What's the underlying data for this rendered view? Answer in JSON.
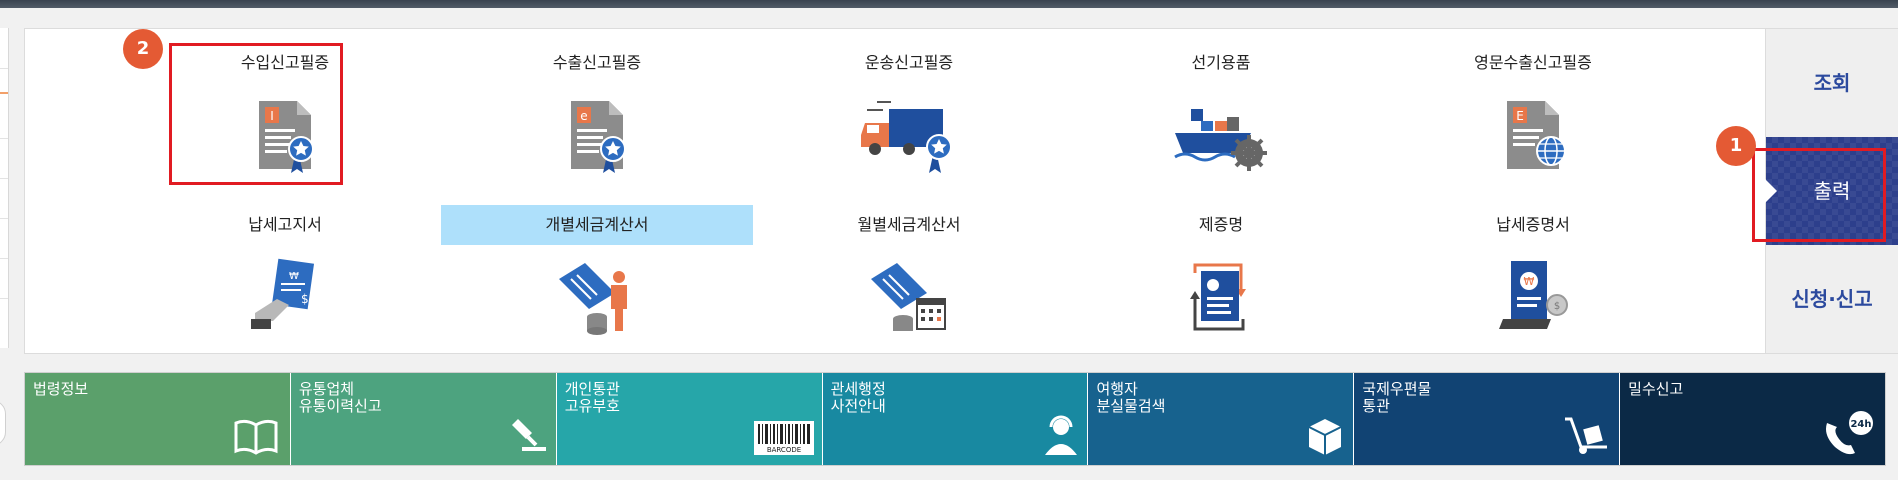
{
  "grid": {
    "items": [
      {
        "label": "수입신고필증",
        "icon": "import-declaration-certificate-icon"
      },
      {
        "label": "수출신고필증",
        "icon": "export-declaration-certificate-icon"
      },
      {
        "label": "운송신고필증",
        "icon": "transport-declaration-certificate-icon"
      },
      {
        "label": "선기용품",
        "icon": "ship-supplies-icon"
      },
      {
        "label": "영문수출신고필증",
        "icon": "english-export-certificate-icon"
      },
      {
        "label": "납세고지서",
        "icon": "tax-notice-icon"
      },
      {
        "label": "개별세금계산서",
        "icon": "individual-tax-invoice-icon"
      },
      {
        "label": "월별세금계산서",
        "icon": "monthly-tax-invoice-icon"
      },
      {
        "label": "제증명",
        "icon": "certificate-icon"
      },
      {
        "label": "납세증명서",
        "icon": "tax-payment-certificate-icon"
      }
    ],
    "selected_index": 6
  },
  "annotations": {
    "badge_1": "1",
    "badge_2": "2"
  },
  "side_tabs": {
    "items": [
      {
        "label": "조회"
      },
      {
        "label": "출력"
      },
      {
        "label": "신청·신고"
      }
    ],
    "active_index": 1
  },
  "services": {
    "items": [
      {
        "lines": [
          "법령정보"
        ],
        "color": "#5ba06b",
        "icon": "book-icon"
      },
      {
        "lines": [
          "유통업체",
          "유통이력신고"
        ],
        "color": "#4da37f",
        "icon": "stamp-icon"
      },
      {
        "lines": [
          "개인통관",
          "고유부호"
        ],
        "color": "#26a6a9",
        "icon": "barcode-icon",
        "icon_text": "BARCODE"
      },
      {
        "lines": [
          "관세행정",
          "사전안내"
        ],
        "color": "#1889a1",
        "icon": "headset-person-icon"
      },
      {
        "lines": [
          "여행자",
          "분실물검색"
        ],
        "color": "#17628e",
        "icon": "package-icon"
      },
      {
        "lines": [
          "국제우편물",
          "통관"
        ],
        "color": "#114373",
        "icon": "hand-truck-icon"
      },
      {
        "lines": [
          "밀수신고"
        ],
        "color": "#0b2946",
        "icon": "24h-phone-icon",
        "icon_text": "24h"
      }
    ]
  },
  "colors": {
    "accent_blue": "#2d3f8c",
    "highlight_red": "#e11b22",
    "badge_orange": "#e45a34",
    "selected_bg": "#aee0fb"
  }
}
